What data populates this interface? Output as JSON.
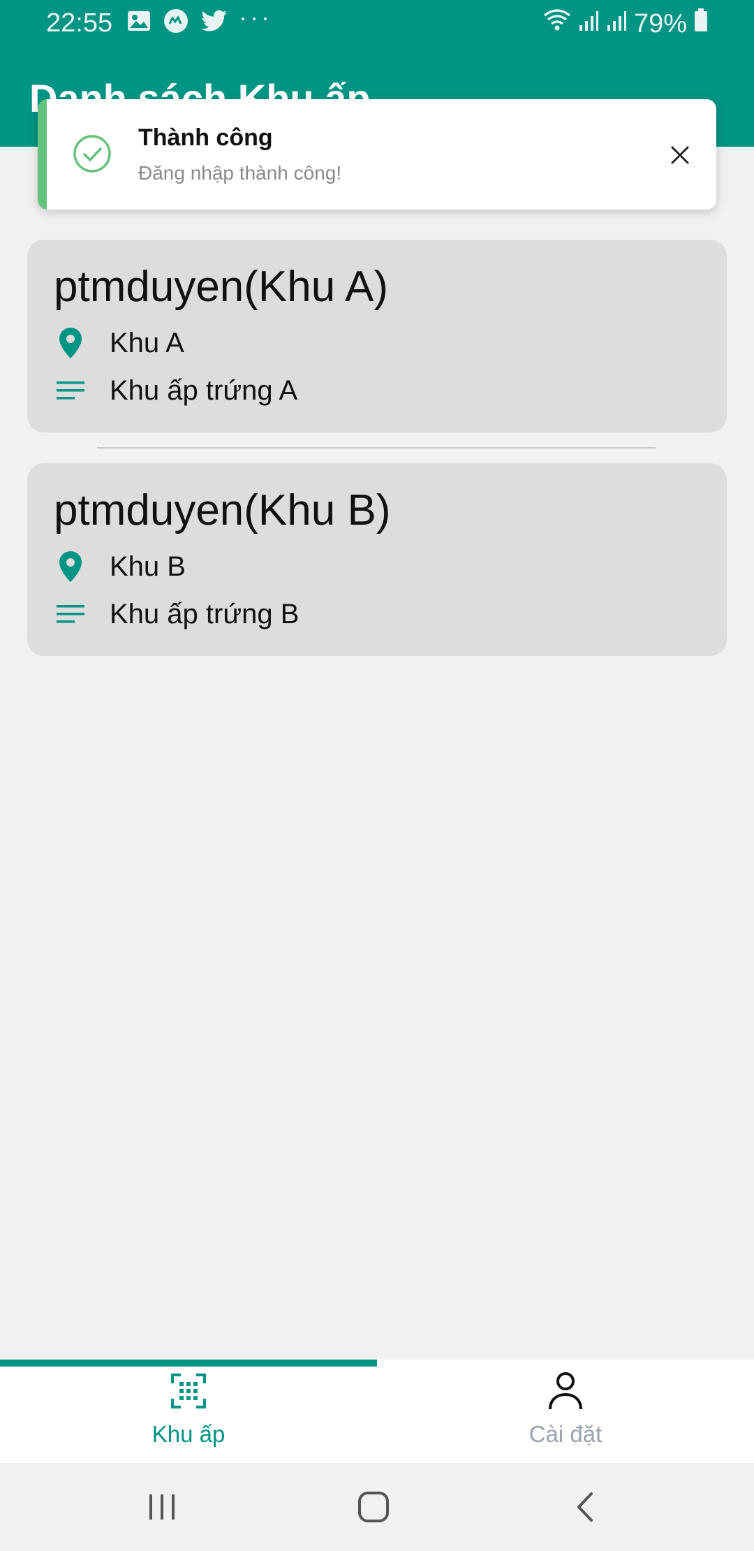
{
  "status_bar": {
    "time": "22:55",
    "battery": "79%",
    "left_icons": [
      "image-icon",
      "messenger-icon",
      "twitter-icon"
    ],
    "overflow": "···",
    "right_icons": [
      "wifi-icon",
      "signal-icon",
      "signal-icon",
      "battery-icon"
    ]
  },
  "header": {
    "title": "Danh sách Khu ấp",
    "color": "#009485"
  },
  "toast": {
    "title": "Thành công",
    "message": "Đăng nhập thành công!",
    "accent_color": "#64c27c",
    "icon": "check-circle-icon"
  },
  "cards": [
    {
      "title": "ptmduyen(Khu A)",
      "location": "Khu A",
      "description": "Khu ấp trứng A"
    },
    {
      "title": "ptmduyen(Khu B)",
      "location": "Khu B",
      "description": "Khu ấp trứng B"
    }
  ],
  "tabs": [
    {
      "label": "Khu ấp",
      "icon": "qr-scan-icon",
      "active": true
    },
    {
      "label": "Cài đặt",
      "icon": "person-icon",
      "active": false
    }
  ],
  "colors": {
    "accent": "#009485",
    "card_bg": "#dddddd",
    "background": "#f1f1f1"
  }
}
